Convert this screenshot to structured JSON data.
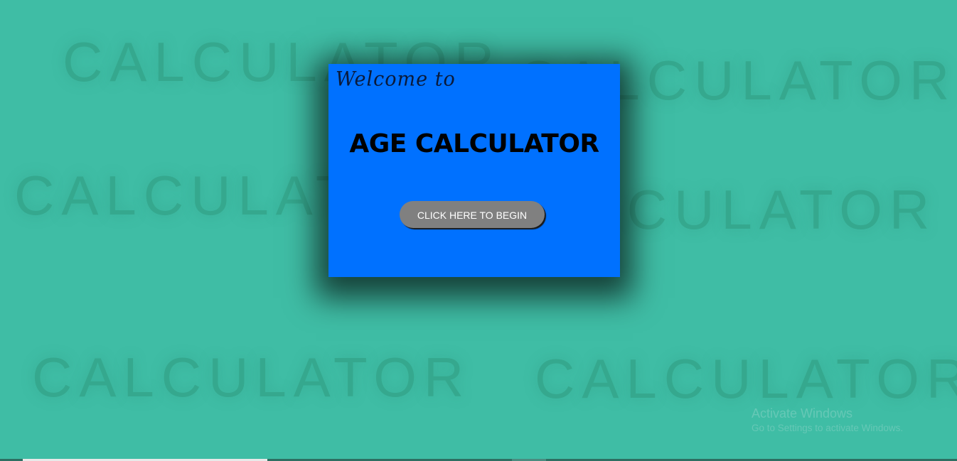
{
  "background": {
    "color": "#3fbda5",
    "watermark_words": [
      "CALCULATOR",
      "CALCULATOR",
      "CALCULATOR",
      "CALCULATOR",
      "CALCULATOR",
      "CALCULATOR"
    ]
  },
  "modal": {
    "color": "#0071ff",
    "welcome_text": "Welcome to",
    "title": "AGE CALCULATOR",
    "begin_button_label": "CLICK HERE TO BEGIN"
  },
  "windows_activation": {
    "title": "Activate Windows",
    "subtitle": "Go to Settings to activate Windows."
  }
}
